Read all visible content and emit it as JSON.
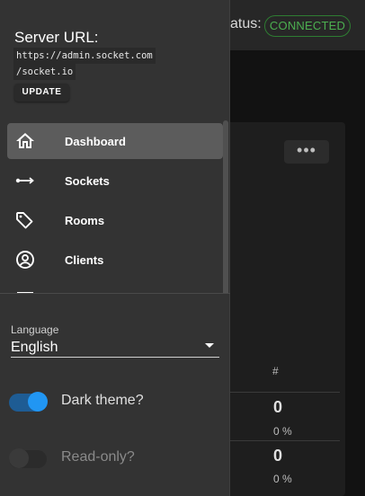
{
  "header": {
    "status_label": "atus:",
    "status_value": "CONNECTED"
  },
  "panel": {
    "more_label": "•••",
    "column_header": "#",
    "rows": [
      {
        "count": "0",
        "percent": "0 %"
      },
      {
        "count": "0",
        "percent": "0 %"
      }
    ]
  },
  "drawer": {
    "server_label": "Server URL:",
    "server_url_line1": "https://admin.socket.com",
    "server_url_line2": "/socket.io",
    "update_label": "UPDATE",
    "nav": [
      {
        "label": "Dashboard",
        "icon": "home-icon",
        "active": true
      },
      {
        "label": "Sockets",
        "icon": "socket-icon",
        "active": false
      },
      {
        "label": "Rooms",
        "icon": "tag-icon",
        "active": false
      },
      {
        "label": "Clients",
        "icon": "account-circle-icon",
        "active": false
      }
    ],
    "language": {
      "label": "Language",
      "value": "English"
    },
    "dark_theme": {
      "label": "Dark theme?",
      "checked": true
    },
    "read_only": {
      "label": "Read-only?",
      "checked": false
    }
  },
  "colors": {
    "accent": "#2196f3",
    "connected": "#4caf50",
    "drawer_bg": "#333333",
    "active_item_bg": "#5c5c5c"
  }
}
